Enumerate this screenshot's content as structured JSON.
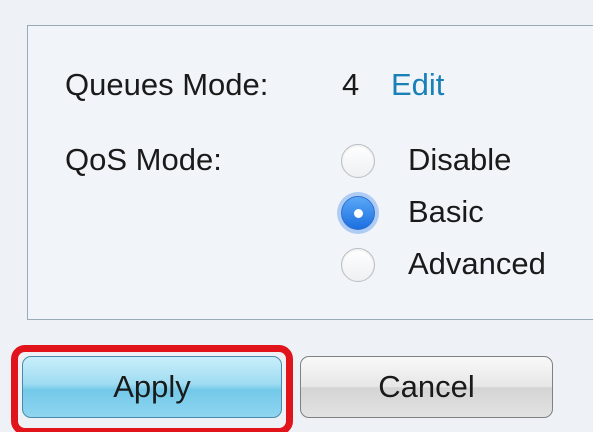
{
  "queues_mode": {
    "label": "Queues Mode:",
    "value": "4",
    "edit_link": "Edit"
  },
  "qos_mode": {
    "label": "QoS Mode:",
    "options": [
      {
        "label": "Disable",
        "checked": false
      },
      {
        "label": "Basic",
        "checked": true
      },
      {
        "label": "Advanced",
        "checked": false
      }
    ],
    "selected": "Basic"
  },
  "actions": {
    "apply_label": "Apply",
    "cancel_label": "Cancel",
    "highlighted": "Apply"
  },
  "colors": {
    "link": "#1a80b8",
    "radio_selected": "#1b6fe0",
    "highlight_border": "#e0141a",
    "apply_button": "#9fdcf2"
  }
}
